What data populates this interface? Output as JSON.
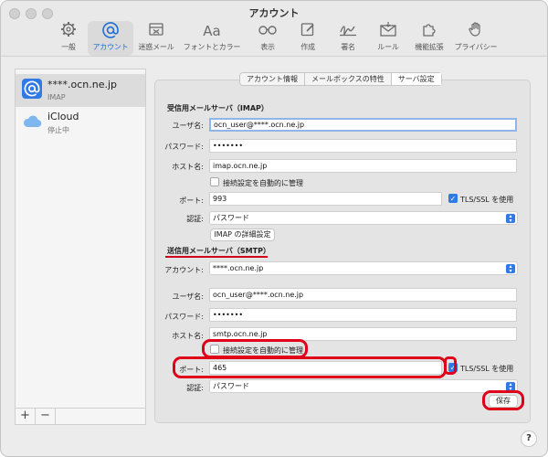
{
  "window": {
    "title": "アカウント"
  },
  "toolbar": {
    "items": [
      {
        "label": "一般",
        "icon": "gear-icon"
      },
      {
        "label": "アカウント",
        "icon": "at-sign-icon"
      },
      {
        "label": "迷惑メール",
        "icon": "junk-tray-icon"
      },
      {
        "label": "フォントとカラー",
        "icon": "font-icon",
        "glyph": "Aa"
      },
      {
        "label": "表示",
        "icon": "glasses-icon"
      },
      {
        "label": "作成",
        "icon": "compose-icon"
      },
      {
        "label": "署名",
        "icon": "signature-icon"
      },
      {
        "label": "ルール",
        "icon": "rules-icon"
      },
      {
        "label": "機能拡張",
        "icon": "puzzle-icon"
      },
      {
        "label": "プライバシー",
        "icon": "hand-icon"
      }
    ],
    "active": "アカウント"
  },
  "sidebar": {
    "accounts": [
      {
        "name": "****.ocn.ne.jp",
        "sub": "IMAP",
        "icon": "at-sign-icon",
        "selected": true
      },
      {
        "name": "iCloud",
        "sub": "停止中",
        "icon": "cloud-icon",
        "selected": false
      }
    ],
    "add_label": "+",
    "remove_label": "−"
  },
  "tabs": [
    {
      "label": "アカウント情報",
      "active": false
    },
    {
      "label": "メールボックスの特性",
      "active": false
    },
    {
      "label": "サーバ設定",
      "active": true
    }
  ],
  "incoming": {
    "heading": "受信用メールサーバ（IMAP）",
    "username_label": "ユーザ名:",
    "username": "ocn_user@****.ocn.ne.jp",
    "password_label": "パスワード:",
    "password": "•••••••",
    "host_label": "ホスト名:",
    "host": "imap.ocn.ne.jp",
    "auto_manage_label": "接続設定を自動的に管理",
    "auto_manage": false,
    "port_label": "ポート:",
    "port": "993",
    "tls_label": "TLS/SSL を使用",
    "tls": true,
    "auth_label": "認証:",
    "auth": "パスワード",
    "advanced_button": "IMAP の詳細設定"
  },
  "outgoing": {
    "heading": "送信用メールサーバ（SMTP）",
    "account_label": "アカウント:",
    "account": "****.ocn.ne.jp",
    "username_label": "ユーザ名:",
    "username": "ocn_user@****.ocn.ne.jp",
    "password_label": "パスワード:",
    "password": "•••••••",
    "host_label": "ホスト名:",
    "host": "smtp.ocn.ne.jp",
    "auto_manage_label": "接続設定を自動的に管理",
    "auto_manage": false,
    "port_label": "ポート:",
    "port": "465",
    "tls_label": "TLS/SSL を使用",
    "tls": true,
    "auth_label": "認証:",
    "auth": "パスワード"
  },
  "save_button": "保存",
  "help_button": "?",
  "colors": {
    "accent": "#2f7ae5",
    "highlight": "#e0001a"
  }
}
